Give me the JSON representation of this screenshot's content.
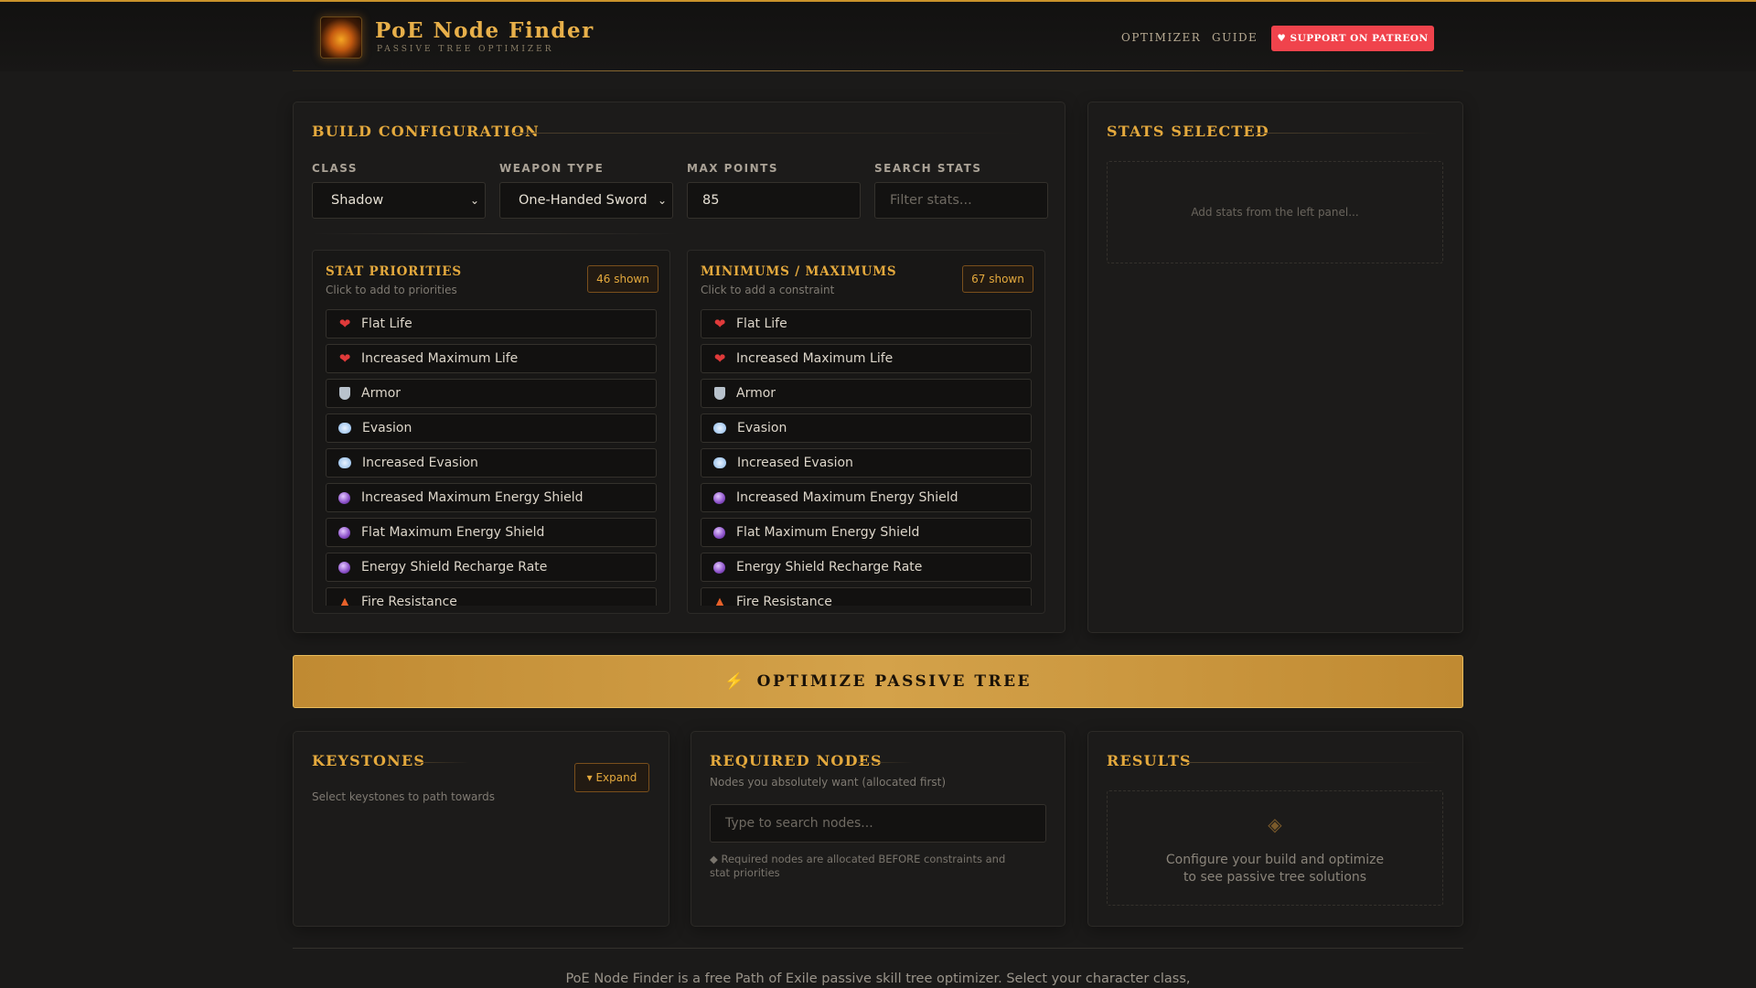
{
  "brand": {
    "title": "PoE Node Finder",
    "subtitle": "PASSIVE TREE OPTIMIZER"
  },
  "nav": {
    "optimizer": "OPTIMIZER",
    "guide": "GUIDE",
    "patreon": "♥ SUPPORT ON PATREON"
  },
  "build": {
    "title": "BUILD CONFIGURATION",
    "class_label": "CLASS",
    "class_value": "Shadow",
    "weapon_label": "WEAPON TYPE",
    "weapon_value": "One-Handed Sword",
    "points_label": "MAX POINTS",
    "points_value": "85",
    "search_label": "SEARCH STATS",
    "search_placeholder": "Filter stats..."
  },
  "priorities": {
    "title": "STAT PRIORITIES",
    "hint": "Click to add to priorities",
    "count": "46 shown",
    "items": [
      {
        "icon": "heart-icon",
        "label": "Flat Life"
      },
      {
        "icon": "heart-icon",
        "label": "Increased Maximum Life"
      },
      {
        "icon": "shield-icon",
        "label": "Armor"
      },
      {
        "icon": "wind-icon",
        "label": "Evasion"
      },
      {
        "icon": "wind-icon",
        "label": "Increased Evasion"
      },
      {
        "icon": "crystal-ball-icon",
        "label": "Increased Maximum Energy Shield"
      },
      {
        "icon": "crystal-ball-icon",
        "label": "Flat Maximum Energy Shield"
      },
      {
        "icon": "crystal-ball-icon",
        "label": "Energy Shield Recharge Rate"
      },
      {
        "icon": "fire-icon",
        "label": "Fire Resistance"
      }
    ]
  },
  "constraints": {
    "title": "MINIMUMS / MAXIMUMS",
    "hint": "Click to add a constraint",
    "count": "67 shown",
    "items": [
      {
        "icon": "heart-icon",
        "label": "Flat Life"
      },
      {
        "icon": "heart-icon",
        "label": "Increased Maximum Life"
      },
      {
        "icon": "shield-icon",
        "label": "Armor"
      },
      {
        "icon": "wind-icon",
        "label": "Evasion"
      },
      {
        "icon": "wind-icon",
        "label": "Increased Evasion"
      },
      {
        "icon": "crystal-ball-icon",
        "label": "Increased Maximum Energy Shield"
      },
      {
        "icon": "crystal-ball-icon",
        "label": "Flat Maximum Energy Shield"
      },
      {
        "icon": "crystal-ball-icon",
        "label": "Energy Shield Recharge Rate"
      },
      {
        "icon": "fire-icon",
        "label": "Fire Resistance"
      }
    ]
  },
  "stats_selected": {
    "title": "STATS SELECTED",
    "empty": "Add stats from the left panel..."
  },
  "optimize": {
    "label": "OPTIMIZE PASSIVE TREE"
  },
  "keystones": {
    "title": "KEYSTONES",
    "expand": "▾ Expand",
    "hint": "Select keystones to path towards"
  },
  "required": {
    "title": "REQUIRED NODES",
    "hint": "Nodes you absolutely want (allocated first)",
    "placeholder": "Type to search nodes...",
    "note": "◆ Required nodes are allocated BEFORE constraints and stat priorities"
  },
  "results": {
    "title": "RESULTS",
    "line1": "Configure your build and optimize",
    "line2": "to see passive tree solutions"
  },
  "footer": {
    "text": "PoE Node Finder is a free Path of Exile passive skill tree optimizer. Select your character class,"
  }
}
